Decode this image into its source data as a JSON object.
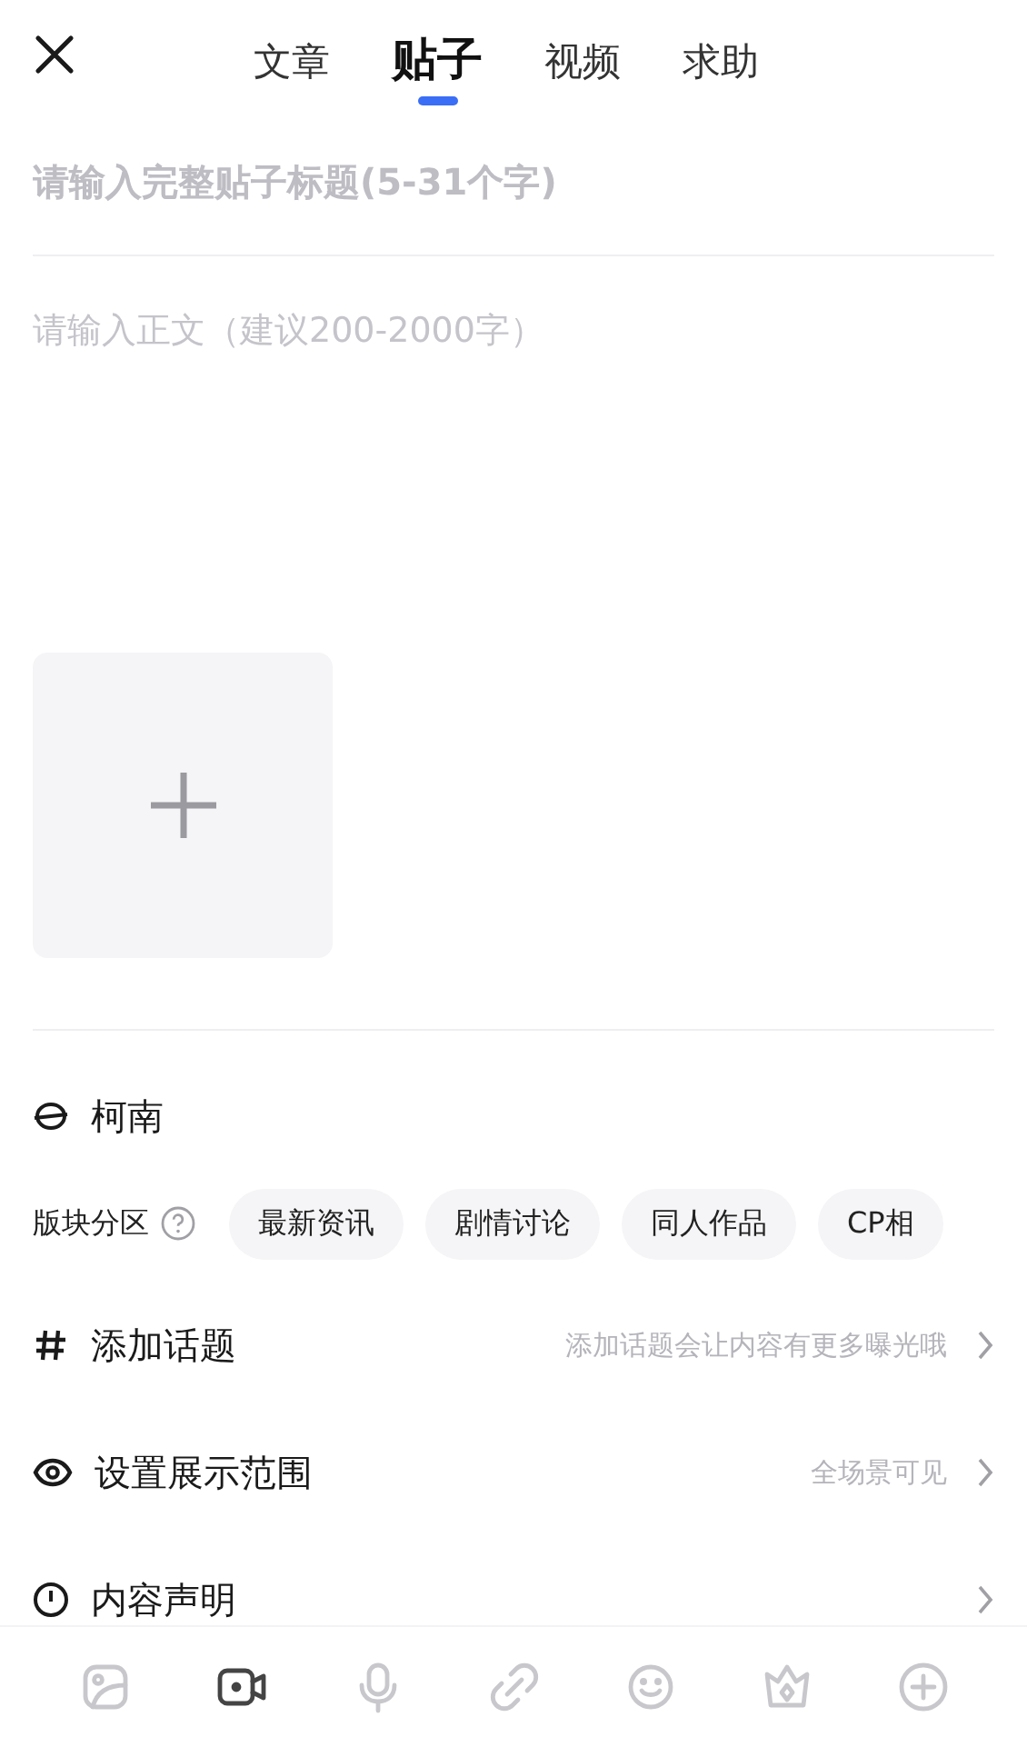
{
  "tabs": [
    {
      "label": "文章",
      "selected": false
    },
    {
      "label": "贴子",
      "selected": true
    },
    {
      "label": "视频",
      "selected": false
    },
    {
      "label": "求助",
      "selected": false
    }
  ],
  "title_field": {
    "placeholder": "请输入完整贴子标题(5-31个字)"
  },
  "body_field": {
    "placeholder": "请输入正文（建议200-2000字）"
  },
  "forum": {
    "name": "柯南"
  },
  "sections": {
    "label": "版块分区",
    "chips": [
      "最新资讯",
      "剧情讨论",
      "同人作品",
      "CP相"
    ]
  },
  "rows": [
    {
      "kind": "topic",
      "label": "添加话题",
      "hint": "添加话题会让内容有更多曝光哦"
    },
    {
      "kind": "visibility",
      "label": "设置展示范围",
      "hint": "全场景可见"
    },
    {
      "kind": "statement",
      "label": "内容声明"
    }
  ],
  "toolbar": [
    {
      "kind": "image",
      "selected": false
    },
    {
      "kind": "video",
      "selected": true
    },
    {
      "kind": "voice",
      "selected": false
    },
    {
      "kind": "link",
      "selected": false
    },
    {
      "kind": "emoji",
      "selected": false
    },
    {
      "kind": "crown",
      "selected": false
    },
    {
      "kind": "more",
      "selected": false
    }
  ]
}
